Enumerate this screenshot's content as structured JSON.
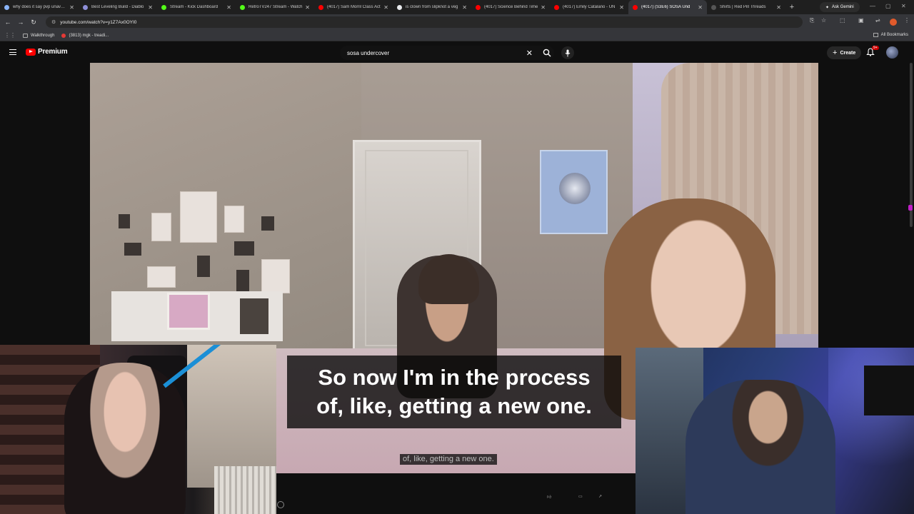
{
  "browser": {
    "tabs": [
      {
        "title": "why does it say pvp unavaila",
        "favicon_color": "#8ab4f8"
      },
      {
        "title": "Best Leveling Build - Diablo",
        "favicon_color": "#8e8fd8"
      },
      {
        "title": "Stream - Kick Dashboard",
        "favicon_color": "#53fc18"
      },
      {
        "title": "RetroTV247 Stream - Watch",
        "favicon_color": "#53fc18"
      },
      {
        "title": "(4017) Sam Morril Class Act",
        "favicon_color": "#ff0000"
      },
      {
        "title": "is clown from slipknot a veg",
        "favicon_color": "#e8eaed"
      },
      {
        "title": "(4017) Science Behind Time",
        "favicon_color": "#ff0000"
      },
      {
        "title": "(4017) Emily Catalano - UN",
        "favicon_color": "#ff0000"
      },
      {
        "title": "(4017) (S3E6) SOSA Und",
        "favicon_color": "#ff0000"
      },
      {
        "title": "Shirts | Red Pill Threads",
        "favicon_color": "#555555"
      }
    ],
    "active_tab_index": 8,
    "ask_gemini": "Ask Gemini",
    "url": "youtube.com/watch?v=y1Z7Ax0OYI0",
    "bookmarks": [
      {
        "label": "Walkthrough",
        "type": "folder"
      },
      {
        "label": "(3813) mgk - treadi...",
        "type": "youtube"
      }
    ],
    "all_bookmarks": "All Bookmarks"
  },
  "youtube": {
    "brand": "Premium",
    "search_query": "sosa undercover",
    "create_label": "Create",
    "notification_badge": "9+",
    "colors": {
      "accent": "#ff0000",
      "background": "#0f0f0f"
    }
  },
  "video": {
    "caption_lines": [
      "So now I'm in the process",
      "of, like, getting a new one."
    ],
    "subtitle_small": "of, like, getting a new one."
  }
}
